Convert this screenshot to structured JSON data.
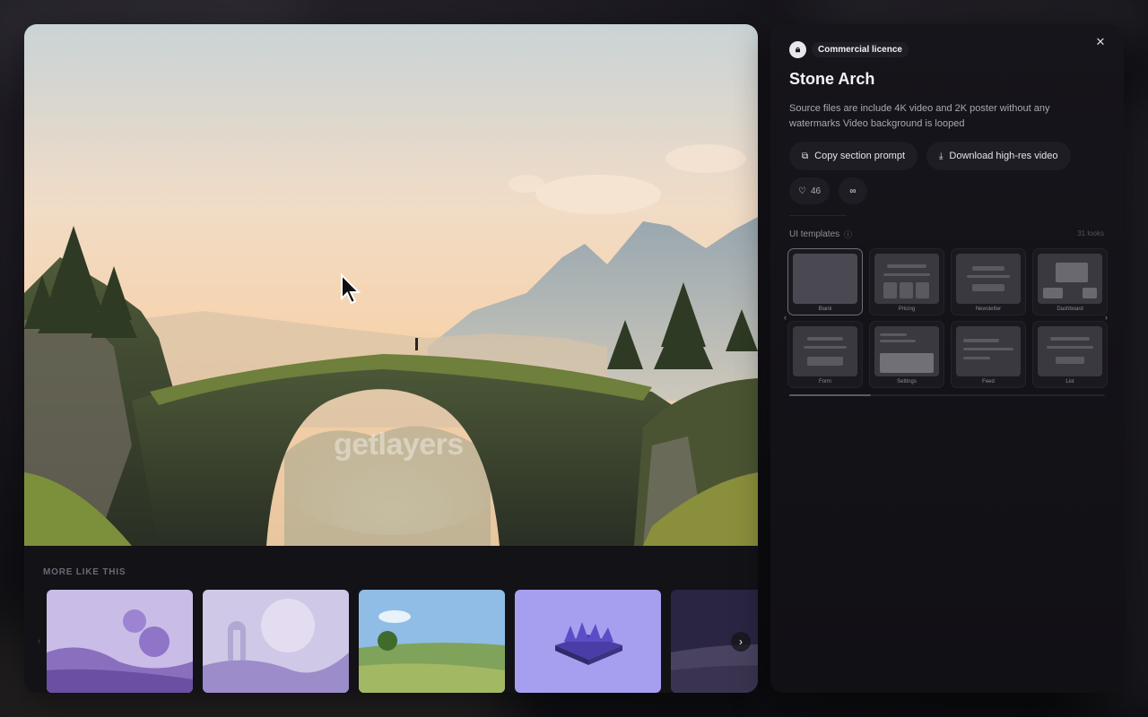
{
  "hero": {
    "watermark": "getlayers"
  },
  "more_like_this": {
    "label": "MORE LIKE THIS",
    "next_icon": "chevron-right-icon"
  },
  "panel": {
    "close_icon": "close-icon",
    "licence": {
      "icon": "lock-icon",
      "label": "Commercial licence"
    },
    "title": "Stone Arch",
    "description": "Source files are include 4K video and 2K poster without any watermarks Video background is looped",
    "actions": {
      "copy_prompt": {
        "icon": "copy-icon",
        "label": "Copy section prompt"
      },
      "download": {
        "icon": "download-icon",
        "label": "Download high-res video"
      }
    },
    "likes": {
      "icon": "heart-icon",
      "count": "46"
    },
    "share_icon": "link-icon",
    "templates": {
      "heading": "UI templates",
      "info_icon": "info-icon",
      "count": "31 looks",
      "items": [
        {
          "caption": "Blank"
        },
        {
          "caption": "Pricing"
        },
        {
          "caption": "Newsletter"
        },
        {
          "caption": "Dashboard"
        },
        {
          "caption": "Form"
        },
        {
          "caption": "Settings"
        },
        {
          "caption": "Feed"
        },
        {
          "caption": "List"
        }
      ]
    }
  },
  "colors": {
    "panel_bg": "#16151b",
    "pill_bg": "#1e1d24",
    "accent_text": "#f4f3f7"
  }
}
